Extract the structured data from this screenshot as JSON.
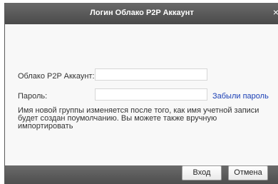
{
  "dialog": {
    "title": "Логин Облако P2P Аккаунт",
    "close_glyph": "×"
  },
  "form": {
    "account_label": "Облако P2P Аккаунт:",
    "account_value": "",
    "password_label": "Пароль:",
    "password_value": "",
    "forgot_link": "Забыли пароль",
    "note": "Имя новой группы изменяется после того, как имя учетной записи будет создан поумолчанию. Вы можете также вручную импортировать"
  },
  "buttons": {
    "login": "Вход",
    "cancel": "Отмена"
  }
}
